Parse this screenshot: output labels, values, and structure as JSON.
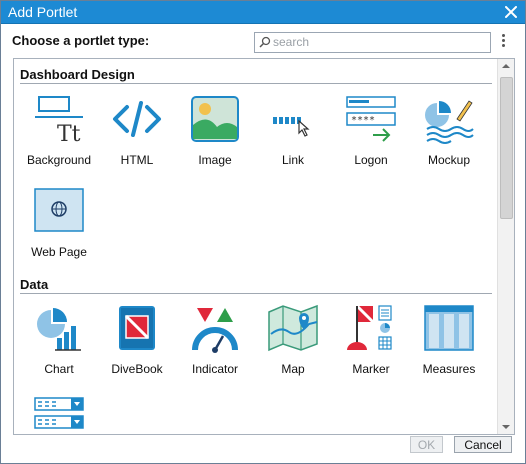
{
  "window": {
    "title": "Add Portlet"
  },
  "header": {
    "label": "Choose a portlet type:",
    "search_placeholder": "search",
    "search_value": ""
  },
  "sections": [
    {
      "title": "Dashboard Design",
      "items": [
        {
          "label": "Background",
          "icon": "background-icon"
        },
        {
          "label": "HTML",
          "icon": "html-code-icon"
        },
        {
          "label": "Image",
          "icon": "image-icon"
        },
        {
          "label": "Link",
          "icon": "link-icon"
        },
        {
          "label": "Logon",
          "icon": "logon-icon"
        },
        {
          "label": "Mockup",
          "icon": "mockup-icon"
        },
        {
          "label": "Web Page",
          "icon": "web-page-icon"
        }
      ]
    },
    {
      "title": "Data",
      "items": [
        {
          "label": "Chart",
          "icon": "chart-icon"
        },
        {
          "label": "DiveBook",
          "icon": "divebook-icon"
        },
        {
          "label": "Indicator",
          "icon": "indicator-icon"
        },
        {
          "label": "Map",
          "icon": "map-icon"
        },
        {
          "label": "Marker",
          "icon": "marker-icon"
        },
        {
          "label": "Measures",
          "icon": "measures-icon"
        }
      ]
    }
  ],
  "footer": {
    "ok_label": "OK",
    "cancel_label": "Cancel"
  },
  "colors": {
    "titlebar": "#1d8ad4",
    "icon_blue": "#1e88c8",
    "icon_red": "#e0283a",
    "icon_green": "#2e9e4a"
  }
}
